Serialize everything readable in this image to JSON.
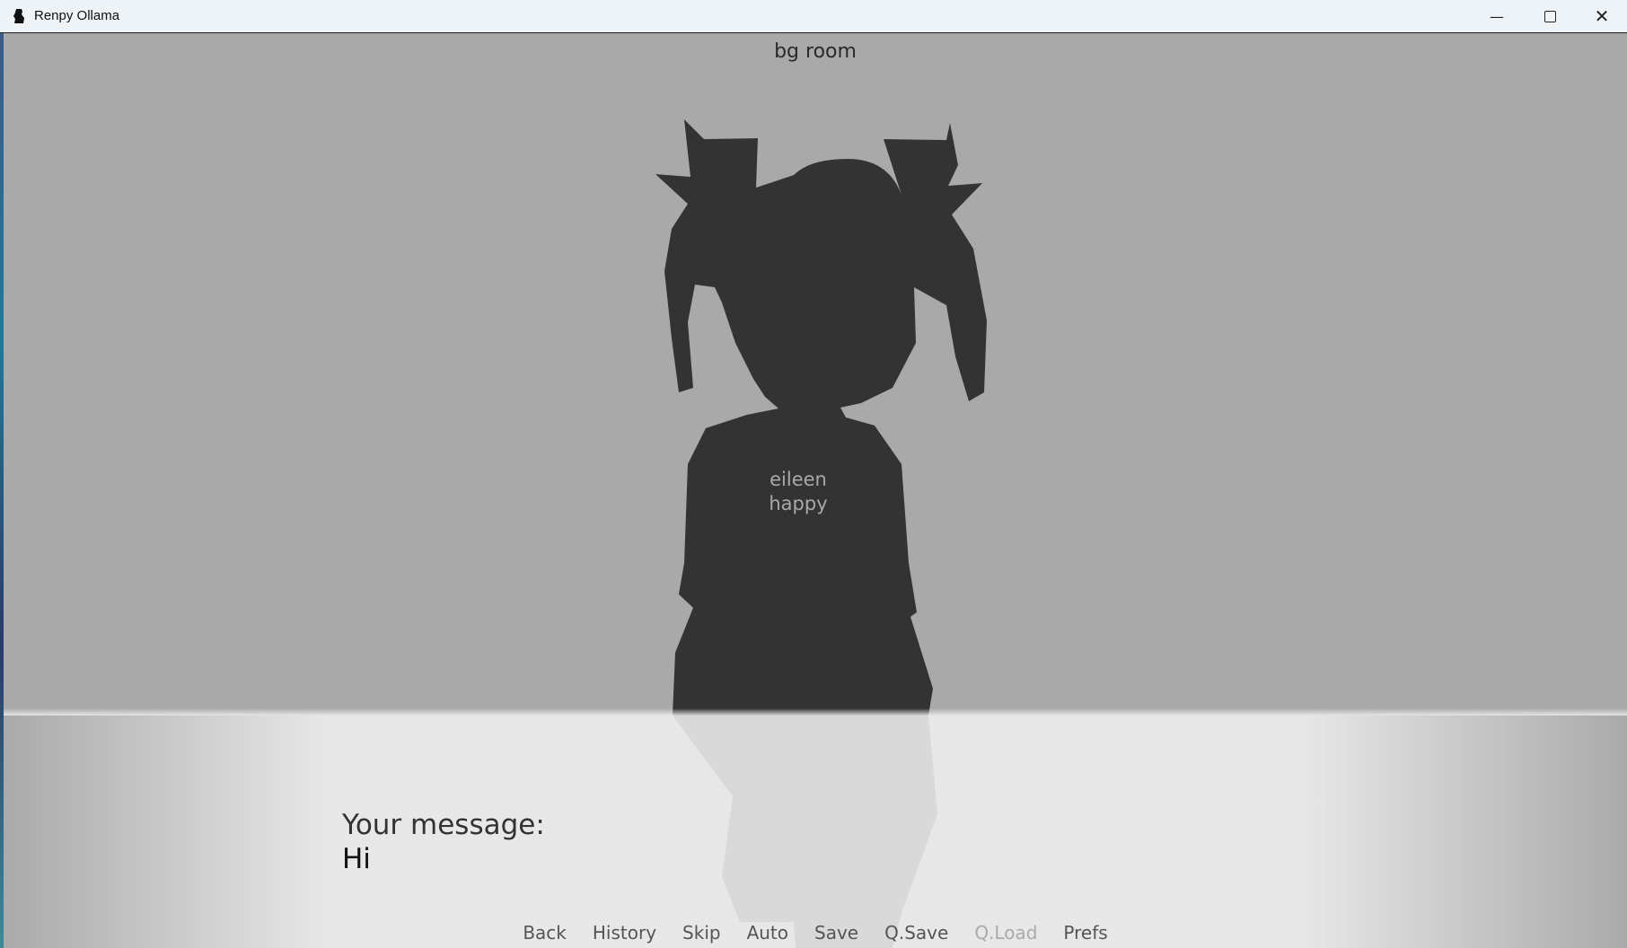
{
  "window": {
    "title": "Renpy Ollama",
    "app_icon": "renpy-icon",
    "controls": [
      "minimize-icon",
      "maximize-icon",
      "close-icon"
    ]
  },
  "scene": {
    "background_label": "bg room",
    "character_label_line1": "eileen",
    "character_label_line2": "happy"
  },
  "dialogue": {
    "speaker": "Your message:",
    "text": "Hi"
  },
  "quick_menu": [
    {
      "label": "Back",
      "enabled": true
    },
    {
      "label": "History",
      "enabled": true
    },
    {
      "label": "Skip",
      "enabled": true
    },
    {
      "label": "Auto",
      "enabled": true
    },
    {
      "label": "Save",
      "enabled": true
    },
    {
      "label": "Q.Save",
      "enabled": true
    },
    {
      "label": "Q.Load",
      "enabled": false
    },
    {
      "label": "Prefs",
      "enabled": true
    }
  ]
}
